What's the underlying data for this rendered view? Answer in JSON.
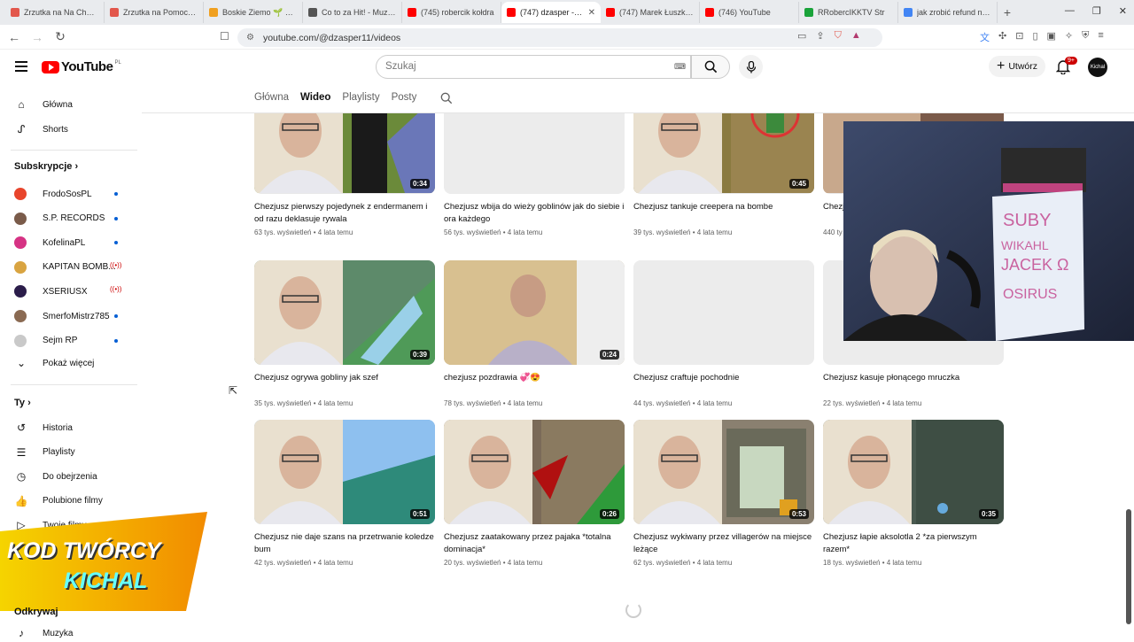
{
  "browser": {
    "tabs": [
      {
        "title": "Zrzutka na Na Chore C",
        "color": "#e2574c"
      },
      {
        "title": "Zrzutka na Pomoc dla",
        "color": "#e2574c"
      },
      {
        "title": "Boskie Ziemo 🌱 Reko",
        "color": "#f0a020"
      },
      {
        "title": "Co to za Hit! - Muzyca",
        "color": "#555555"
      },
      {
        "title": "(745) robercik kołdra",
        "color": "#ff0000"
      },
      {
        "title": "(747) dzasper - Yo",
        "color": "#ff0000",
        "active": true
      },
      {
        "title": "(747) Marek Łuszkiew",
        "color": "#ff0000"
      },
      {
        "title": "(746) YouTube",
        "color": "#ff0000"
      },
      {
        "title": "RRobercIKKTV Str",
        "color": "#1aa33a"
      },
      {
        "title": "jak zrobić refund na st",
        "color": "#4285f4"
      }
    ],
    "url": "youtube.com/@dzasper11/videos"
  },
  "header": {
    "logo_text": "YouTube",
    "logo_region": "PL",
    "search_placeholder": "Szukaj",
    "create_label": "Utwórz",
    "notif_badge": "9+",
    "avatar_text": "Kichal"
  },
  "sidebar": {
    "main": [
      {
        "label": "Główna",
        "icon": "home-icon"
      },
      {
        "label": "Shorts",
        "icon": "shorts-icon"
      }
    ],
    "subs_header": "Subskrypcje",
    "subs": [
      {
        "label": "FrodoSosPL",
        "color": "#e8452c",
        "status": "dot"
      },
      {
        "label": "S.P. RECORDS",
        "color": "#7a5b4a",
        "status": "dot"
      },
      {
        "label": "KofelinaPL",
        "color": "#d63384",
        "status": "dot"
      },
      {
        "label": "KAPITAN BOMB...",
        "color": "#d9a441",
        "status": "live"
      },
      {
        "label": "XSERIUSX",
        "color": "#2b1d4a",
        "status": "live"
      },
      {
        "label": "SmerfoMistrz785",
        "color": "#8a6a52",
        "status": "dot"
      },
      {
        "label": "Sejm RP",
        "color": "#c9c9c9",
        "status": "dot"
      }
    ],
    "show_more": "Pokaż więcej",
    "you_header": "Ty",
    "you": [
      {
        "label": "Historia",
        "icon": "history-icon"
      },
      {
        "label": "Playlisty",
        "icon": "playlist-icon"
      },
      {
        "label": "Do obejrzenia",
        "icon": "watch-later-icon"
      },
      {
        "label": "Polubione filmy",
        "icon": "like-icon"
      },
      {
        "label": "Twoje filmy",
        "icon": "your-videos-icon"
      }
    ],
    "explore_header": "Odkrywaj",
    "music": "Muzyka"
  },
  "channel_tabs": [
    "Główna",
    "Wideo",
    "Playlisty",
    "Posty"
  ],
  "active_tab": "Wideo",
  "videos": [
    {
      "title": "Chezjusz pierwszy pojedynek z endermanem i od razu deklasuje rywala",
      "meta": "63 tys. wyświetleń • 4 lata temu",
      "duration": "0:34",
      "thumb": "enderman"
    },
    {
      "title": "Chezjusz wbija do wieży goblinów jak do siebie i ora każdego",
      "meta": "56 tys. wyświetleń • 4 lata temu",
      "duration": "",
      "thumb": "blank"
    },
    {
      "title": "Chezjusz tankuje creepera na bombe",
      "meta": "39 tys. wyświetleń • 4 lata temu",
      "duration": "0:45",
      "thumb": "creeper"
    },
    {
      "title": "Chezj",
      "meta": "440 ty",
      "duration": "",
      "thumb": "person"
    },
    {
      "title": "Chezjusz ogrywa gobliny jak szef",
      "meta": "35 tys. wyświetleń • 4 lata temu",
      "duration": "0:39",
      "thumb": "goblin"
    },
    {
      "title": "chezjusz pozdrawia 💞😍",
      "meta": "78 tys. wyświetleń • 4 lata temu",
      "duration": "0:24",
      "thumb": "desk"
    },
    {
      "title": "Chezjusz craftuje pochodnie",
      "meta": "44 tys. wyświetleń • 4 lata temu",
      "duration": "",
      "thumb": "blank"
    },
    {
      "title": "Chezjusz kasuje płonącego mruczka",
      "meta": "22 tys. wyświetleń • 4 lata temu",
      "duration": "",
      "thumb": "blank"
    },
    {
      "title": "Chezjusz nie daje szans na przetrwanie koledze bum",
      "meta": "42 tys. wyświetleń • 4 lata temu",
      "duration": "0:51",
      "thumb": "sky"
    },
    {
      "title": "Chezjusz zaatakowany przez pajaka *totalna dominacja*",
      "meta": "20 tys. wyświetleń • 4 lata temu",
      "duration": "0:26",
      "thumb": "spider"
    },
    {
      "title": "Chezjusz wykiwany przez villagerów na miejsce leżące",
      "meta": "62 tys. wyświetleń • 4 lata temu",
      "duration": "0:53",
      "thumb": "village"
    },
    {
      "title": "Chezjusz łapie aksolotla 2 *za pierwszym razem*",
      "meta": "18 tys. wyświetleń • 4 lata temu",
      "duration": "0:35",
      "thumb": "axolotl"
    }
  ],
  "promo": {
    "line1": "KOD TWÓRCY",
    "line2": "KICHAL"
  },
  "webcam_board_text": "SUBY\nWIKAHL\nJACEK\nKE\nOSIRUS"
}
